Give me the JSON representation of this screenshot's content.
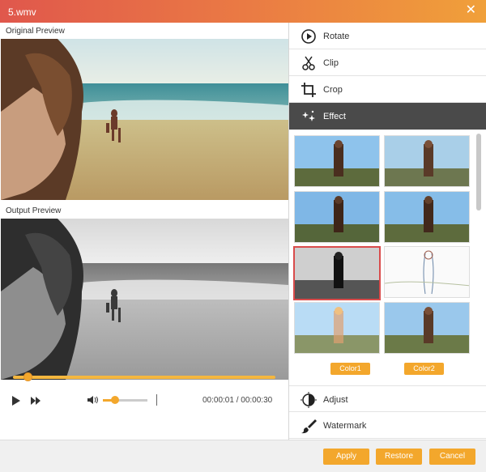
{
  "window": {
    "title": "5.wmv",
    "close_icon": "close-icon"
  },
  "preview": {
    "original_label": "Original Preview",
    "output_label": "Output Preview"
  },
  "player": {
    "current_time": "00:00:01",
    "separator": "/",
    "total_time": "00:00:30",
    "progress_fraction": 0.04,
    "volume_fraction": 0.27
  },
  "menu": {
    "items": [
      {
        "label": "Rotate",
        "icon": "rotate-icon"
      },
      {
        "label": "Clip",
        "icon": "scissors-icon"
      },
      {
        "label": "Crop",
        "icon": "crop-icon"
      },
      {
        "label": "Effect",
        "icon": "sparkle-icon",
        "active": true
      },
      {
        "label": "Adjust",
        "icon": "contrast-icon"
      },
      {
        "label": "Watermark",
        "icon": "brush-icon"
      }
    ]
  },
  "effects": {
    "selected_index": 4,
    "color1_label": "Color1",
    "color2_label": "Color2"
  },
  "buttons": {
    "apply": "Apply",
    "restore": "Restore",
    "cancel": "Cancel"
  },
  "colors": {
    "accent": "#f3a72c",
    "active_menu": "#4a4a4a",
    "selected_border": "#d94b4b"
  }
}
